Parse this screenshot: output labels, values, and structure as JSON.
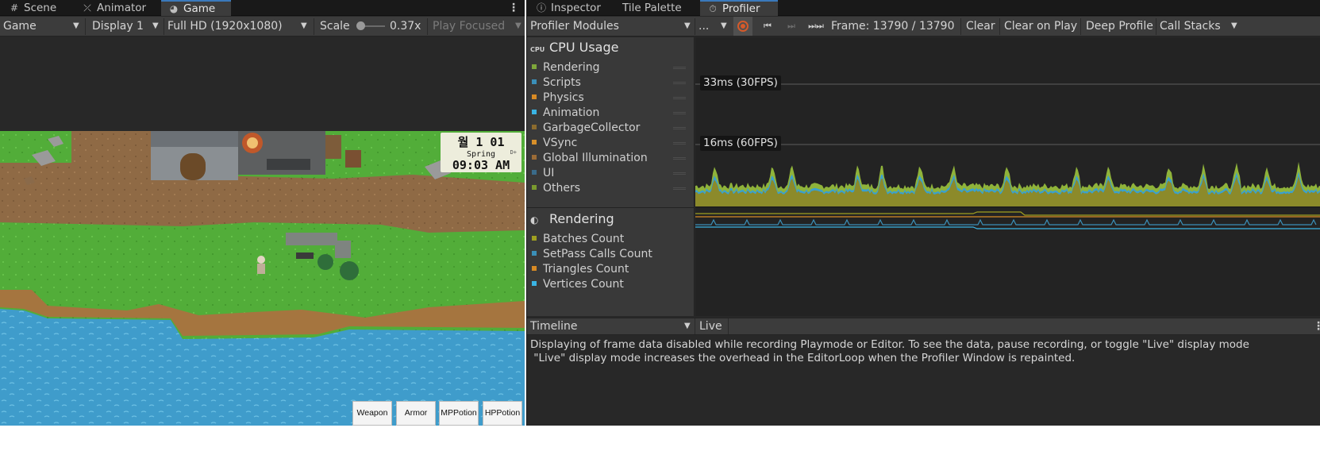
{
  "game_window": {
    "tabs": [
      {
        "label": "Scene",
        "icon": "scene-grid-icon"
      },
      {
        "label": "Animator",
        "icon": "animator-icon"
      },
      {
        "label": "Game",
        "icon": "gamepad-icon",
        "active": true
      }
    ],
    "toolbar": {
      "view_mode": "Game",
      "display": "Display 1",
      "resolution": "Full HD (1920x1080)",
      "scale_label": "Scale",
      "scale_value": "0.37x",
      "play_focused": "Play Focused"
    },
    "hud": {
      "date_line": "월 1 01",
      "season": "Spring",
      "season_suffix": "D+",
      "time": "09:03 AM",
      "buttons": [
        "Weapon",
        "Armor",
        "MPPotion",
        "HPPotion"
      ]
    }
  },
  "profiler_window": {
    "tabs": [
      {
        "label": "Inspector",
        "icon": "info-icon"
      },
      {
        "label": "Tile Palette",
        "icon": ""
      },
      {
        "label": "Profiler",
        "icon": "stopwatch-icon",
        "active": true
      }
    ],
    "toolbar": {
      "modules_dropdown": "Profiler Modules",
      "target_dropdown": "...",
      "frame_label": "Frame: 13790 / 13790",
      "clear": "Clear",
      "clear_on_play": "Clear on Play",
      "deep_profile": "Deep Profile",
      "call_stacks": "Call Stacks"
    },
    "cpu_module": {
      "title": "CPU Usage",
      "icon_text": "CPU",
      "items": [
        {
          "label": "Rendering",
          "color": "#7ea73a"
        },
        {
          "label": "Scripts",
          "color": "#3b8fb8"
        },
        {
          "label": "Physics",
          "color": "#d88a24"
        },
        {
          "label": "Animation",
          "color": "#3ab4e4"
        },
        {
          "label": "GarbageCollector",
          "color": "#8c6b2e"
        },
        {
          "label": "VSync",
          "color": "#d78f2a"
        },
        {
          "label": "Global Illumination",
          "color": "#9b6b36"
        },
        {
          "label": "UI",
          "color": "#3a6b8a"
        },
        {
          "label": "Others",
          "color": "#7a9a2e"
        }
      ],
      "markers": [
        "33ms (30FPS)",
        "16ms (60FPS)"
      ]
    },
    "rendering_module": {
      "title": "Rendering",
      "items": [
        {
          "label": "Batches Count",
          "color": "#a0a020"
        },
        {
          "label": "SetPass Calls Count",
          "color": "#3b8fb8"
        },
        {
          "label": "Triangles Count",
          "color": "#d88a24"
        },
        {
          "label": "Vertices Count",
          "color": "#3ab4e4"
        }
      ]
    },
    "details": {
      "view_dropdown": "Timeline",
      "live_label": "Live",
      "message": "Displaying of frame data disabled while recording Playmode or Editor. To see the data, pause recording, or toggle \"Live\" display mode\n \"Live\" display mode increases the overhead in the EditorLoop when the Profiler Window is repainted."
    }
  }
}
